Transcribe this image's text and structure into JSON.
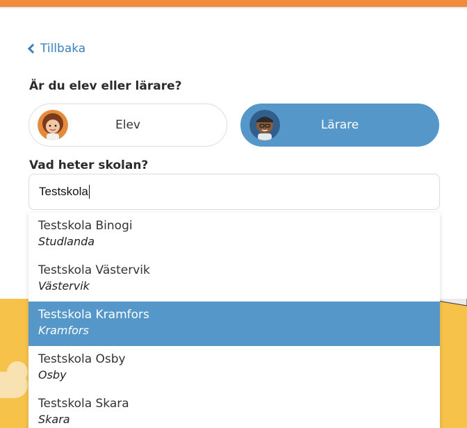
{
  "back": {
    "label": "Tillbaka"
  },
  "role_question": "Är du elev eller lärare?",
  "roles": [
    {
      "label": "Elev",
      "selected": false
    },
    {
      "label": "Lärare",
      "selected": true
    }
  ],
  "school_question": "Vad heter skolan?",
  "search": {
    "value": "Testskola"
  },
  "suggestions": [
    {
      "name": "Testskola Binogi",
      "city": "Studlanda",
      "selected": false
    },
    {
      "name": "Testskola Västervik",
      "city": "Västervik",
      "selected": false
    },
    {
      "name": "Testskola Kramfors",
      "city": "Kramfors",
      "selected": true
    },
    {
      "name": "Testskola Osby",
      "city": "Osby",
      "selected": false
    },
    {
      "name": "Testskola Skara",
      "city": "Skara",
      "selected": false
    }
  ],
  "colors": {
    "accent": "#5497c8",
    "link": "#3a82bf",
    "top_strip": "#f08c3b",
    "footer": "#f6c24a"
  }
}
